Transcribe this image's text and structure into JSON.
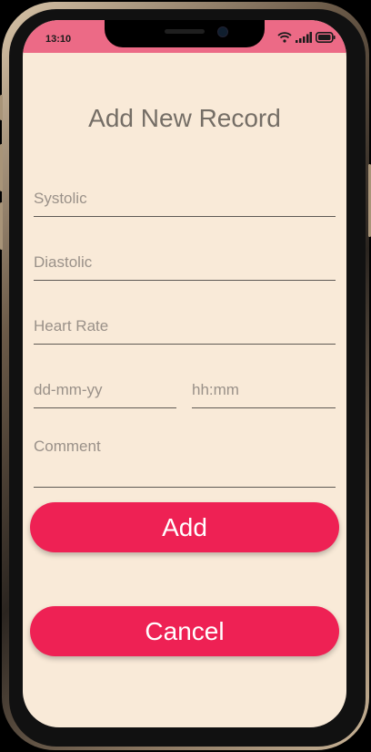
{
  "status_bar": {
    "time": "13:10"
  },
  "form": {
    "title": "Add New Record",
    "systolic_placeholder": "Systolic",
    "diastolic_placeholder": "Diastolic",
    "heart_rate_placeholder": "Heart Rate",
    "date_placeholder": "dd-mm-yy",
    "time_placeholder": "hh:mm",
    "comment_placeholder": "Comment"
  },
  "actions": {
    "add_label": "Add",
    "cancel_label": "Cancel"
  },
  "colors": {
    "background": "#f9ead8",
    "status_bar": "#ec6a86",
    "button": "#ee2154"
  }
}
